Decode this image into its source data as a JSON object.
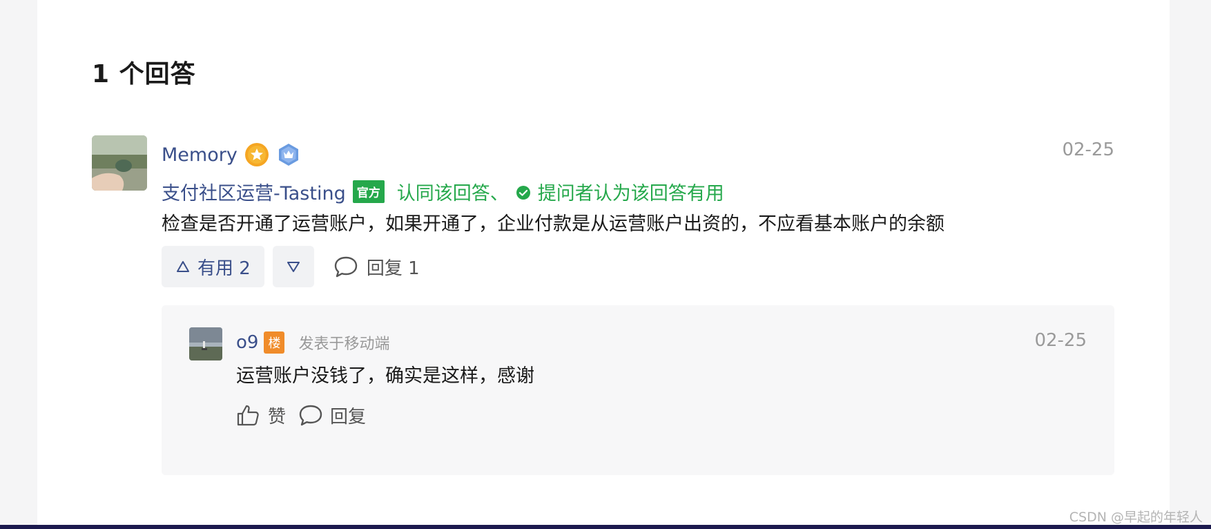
{
  "section": {
    "title": "1 个回答"
  },
  "answer": {
    "author": "Memory",
    "date": "02-25",
    "endorser": "支付社区运营-Tasting",
    "official_tag": "官方",
    "endorse_text": "认同该回答、",
    "accepted_text": "提问者认为该回答有用",
    "content": "检查是否开通了运营账户，如果开通了，企业付款是从运营账户出资的，不应看基本账户的余额",
    "useful_label": "有用 2",
    "reply_label": "回复 1"
  },
  "reply": {
    "author": "o9",
    "floor_tag": "楼",
    "source": "发表于移动端",
    "date": "02-25",
    "content": "运营账户没钱了，确实是这样，感谢",
    "like_label": "赞",
    "reply_label": "回复"
  },
  "watermark": "CSDN @早起的年轻人",
  "colors": {
    "link_blue": "#3a4f8a",
    "green": "#25a84b",
    "orange": "#f08c2a",
    "muted": "#9a9a9a"
  },
  "icons": [
    "gold-star-badge-icon",
    "blue-crown-badge-icon",
    "check-circle-icon",
    "up-triangle-icon",
    "down-triangle-icon",
    "comment-icon",
    "thumbs-up-icon"
  ]
}
